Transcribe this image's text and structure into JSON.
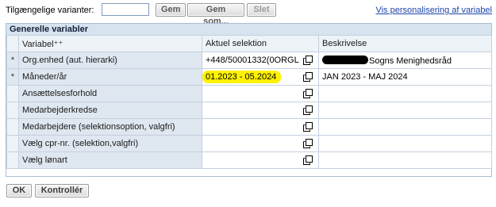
{
  "toolbar": {
    "variants_label": "Tilgængelige varianter:",
    "variant_value": "",
    "save_label": "Gem",
    "save_as_label": "Gem som...",
    "delete_label": "Slet",
    "personalize_link": "Vis personalisering af variabel"
  },
  "panel": {
    "title": "Generelle variabler",
    "headers": {
      "variable": "Variabel⁺⁺",
      "selection": "Aktuel selektion",
      "description": "Beskrivelse"
    },
    "rows": [
      {
        "required": "*",
        "variable": "Org.enhed (aut. hierarki)",
        "selection": "+448/50001332(0ORGL",
        "description": "Sogns Menighedsråd",
        "description_redacted": true,
        "highlight": false
      },
      {
        "required": "*",
        "variable": "Måneder/år",
        "selection": "01.2023 - 05.2024",
        "description": "JAN 2023 - MAJ 2024",
        "description_redacted": false,
        "highlight": true
      },
      {
        "required": "",
        "variable": "Ansættelsesforhold",
        "selection": "",
        "description": "",
        "description_redacted": false,
        "highlight": false
      },
      {
        "required": "",
        "variable": "Medarbejderkredse",
        "selection": "",
        "description": "",
        "description_redacted": false,
        "highlight": false
      },
      {
        "required": "",
        "variable": "Medarbejdere (selektionsoption, valgfri)",
        "selection": "",
        "description": "",
        "description_redacted": false,
        "highlight": false
      },
      {
        "required": "",
        "variable": "Vælg cpr-nr. (selektion,valgfri)",
        "selection": "",
        "description": "",
        "description_redacted": false,
        "highlight": false
      },
      {
        "required": "",
        "variable": "Vælg lønart",
        "selection": "",
        "description": "",
        "description_redacted": false,
        "highlight": false
      }
    ]
  },
  "footer": {
    "ok_label": "OK",
    "check_label": "Kontrollér"
  },
  "icons": {
    "value_help": "copy-icon"
  },
  "colors": {
    "highlight": "#fff200",
    "link": "#1f45a8",
    "header_bar": "#d7e3ef",
    "label_cell": "#dfe7f0"
  }
}
